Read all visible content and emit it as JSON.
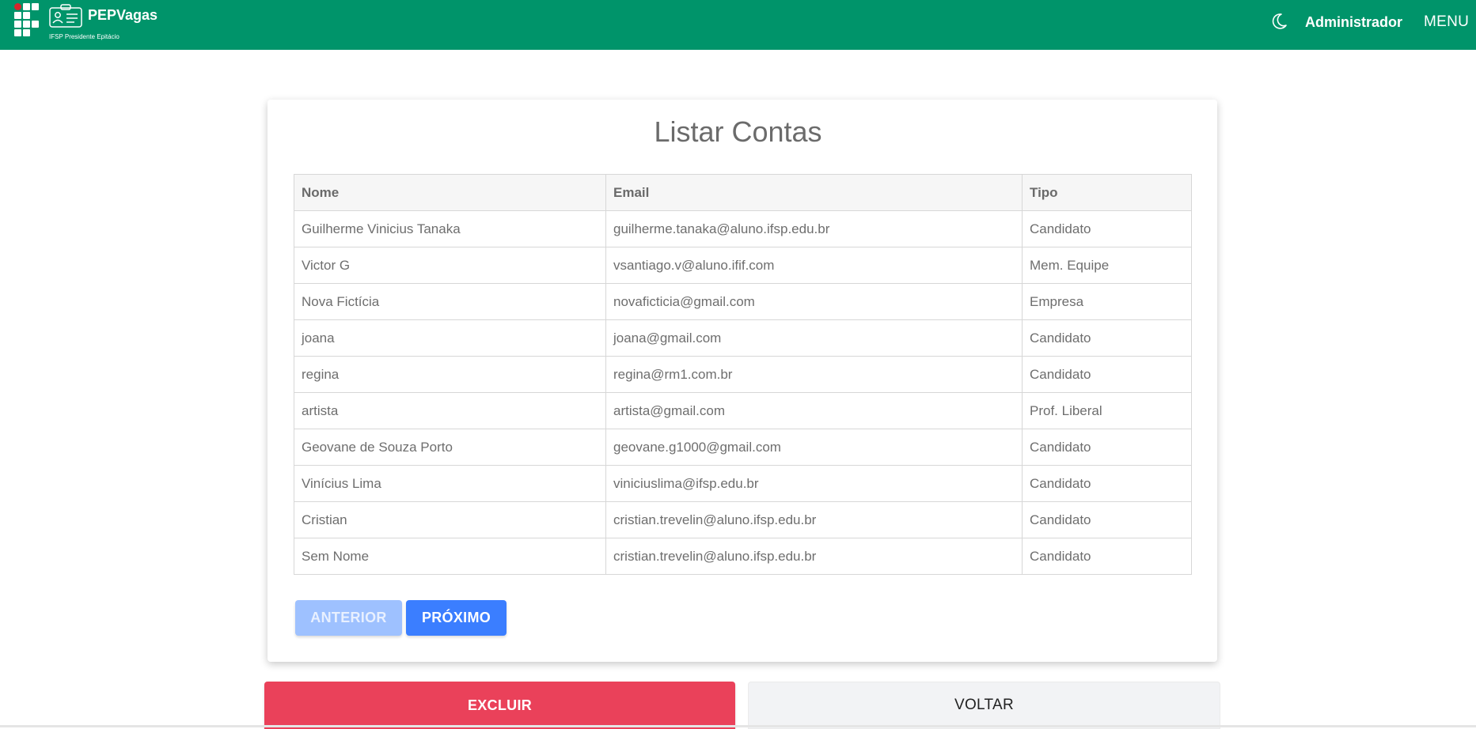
{
  "header": {
    "brand_title": "PEPVagas",
    "brand_subtitle": "IFSP Presidente Epitácio",
    "user_label": "Administrador",
    "menu_label": "MENU",
    "color": "#00946a"
  },
  "page": {
    "title": "Listar Contas"
  },
  "table": {
    "columns": [
      "Nome",
      "Email",
      "Tipo"
    ],
    "rows": [
      [
        "Guilherme Vinicius Tanaka",
        "guilherme.tanaka@aluno.ifsp.edu.br",
        "Candidato"
      ],
      [
        "Victor G",
        "vsantiago.v@aluno.ifif.com",
        "Mem. Equipe"
      ],
      [
        "Nova Fictícia",
        "novaficticia@gmail.com",
        "Empresa"
      ],
      [
        "joana",
        "joana@gmail.com",
        "Candidato"
      ],
      [
        "regina",
        "regina@rm1.com.br",
        "Candidato"
      ],
      [
        "artista",
        "artista@gmail.com",
        "Prof. Liberal"
      ],
      [
        "Geovane de Souza Porto",
        "geovane.g1000@gmail.com",
        "Candidato"
      ],
      [
        "Vinícius Lima",
        "viniciuslima@ifsp.edu.br",
        "Candidato"
      ],
      [
        "Cristian",
        "cristian.trevelin@aluno.ifsp.edu.br",
        "Candidato"
      ],
      [
        "Sem Nome",
        "cristian.trevelin@aluno.ifsp.edu.br",
        "Candidato"
      ]
    ]
  },
  "pagination": {
    "prev_label": "ANTERIOR",
    "next_label": "PRÓXIMO"
  },
  "actions": {
    "delete_label": "EXCLUIR",
    "back_label": "VOLTAR",
    "delete_color": "#ea415a"
  }
}
